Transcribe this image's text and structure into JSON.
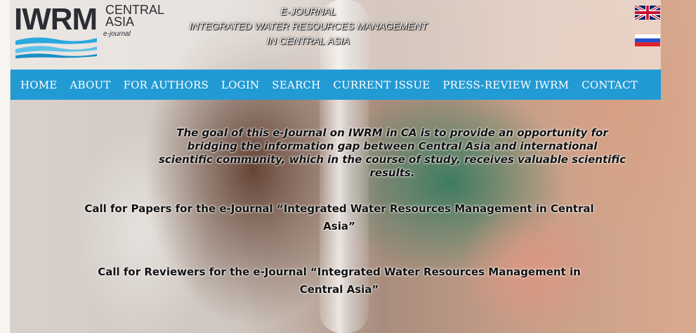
{
  "logo": {
    "main": "IWRM",
    "line1": "CENTRAL",
    "line2": "ASIA",
    "sub": "e-journal"
  },
  "journal_title": {
    "line1": "E-Journal",
    "line2": "Integrated Water Resources Management",
    "line3": "in Central Asia"
  },
  "languages": [
    {
      "icon": "uk-flag-icon"
    },
    {
      "icon": "russia-flag-icon"
    }
  ],
  "nav": {
    "items": [
      "HOME",
      "ABOUT",
      "FOR AUTHORS",
      "LOGIN",
      "SEARCH",
      "CURRENT ISSUE",
      "PRESS-REVIEW IWRM",
      "CONTACT"
    ]
  },
  "content": {
    "goal_text": "The goal of this e-Journal on IWRM in CA is to provide an opportunity for bridging the information gap between Central Asia and international scientific community, which in the course of study, receives valuable scientific results.",
    "call_papers": "Call for Papers for the e-Journal “Integrated Water Resources Management in Central Asia”",
    "call_reviewers": "Call for Reviewers for the e-Journal “Integrated Water Resources Management in Central Asia”"
  },
  "colors": {
    "nav_background": "#229ad4",
    "nav_text": "#ffffff",
    "logo_blue": "#2aa8de",
    "logo_text": "#2c2c34"
  }
}
